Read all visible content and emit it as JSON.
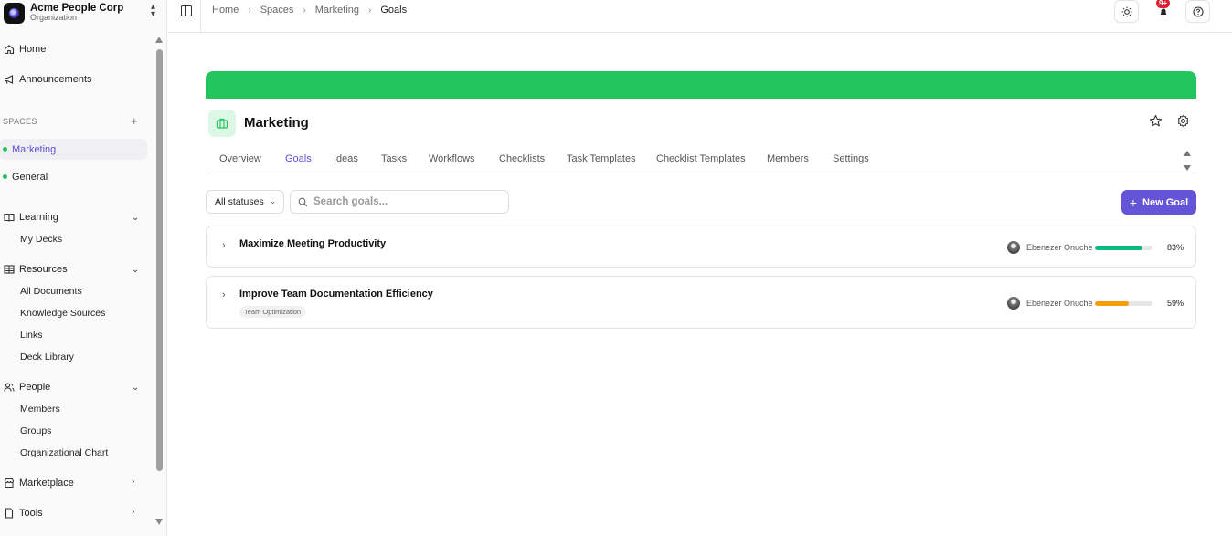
{
  "org": {
    "name": "Acme People Corp",
    "subtitle": "Organization"
  },
  "sidebar": {
    "home": "Home",
    "announcements": "Announcements",
    "spaces_label": "SPACES",
    "spaces": [
      {
        "label": "Marketing",
        "active": true
      },
      {
        "label": "General",
        "active": false
      }
    ],
    "learning": {
      "label": "Learning",
      "items": [
        "My Decks"
      ]
    },
    "resources": {
      "label": "Resources",
      "items": [
        "All Documents",
        "Knowledge Sources",
        "Links",
        "Deck Library"
      ]
    },
    "people": {
      "label": "People",
      "items": [
        "Members",
        "Groups",
        "Organizational Chart"
      ]
    },
    "marketplace": "Marketplace",
    "tools": "Tools"
  },
  "breadcrumb": [
    "Home",
    "Spaces",
    "Marketing",
    "Goals"
  ],
  "notifications": {
    "badge": "9+"
  },
  "space": {
    "title": "Marketing",
    "banner_color": "#22c55e"
  },
  "tabs": [
    "Overview",
    "Goals",
    "Ideas",
    "Tasks",
    "Workflows",
    "Checklists",
    "Task Templates",
    "Checklist Templates",
    "Members",
    "Settings"
  ],
  "active_tab": "Goals",
  "filters": {
    "status": "All statuses",
    "search_placeholder": "Search goals..."
  },
  "new_goal_label": "New Goal",
  "accent_color": "#6455d8",
  "goals": [
    {
      "title": "Maximize Meeting Productivity",
      "tag": "",
      "owner": "Ebenezer Onuche",
      "progress": 83,
      "progress_label": "83%",
      "color": "#10b981"
    },
    {
      "title": "Improve Team Documentation Efficiency",
      "tag": "Team Optimization",
      "owner": "Ebenezer Onuche",
      "progress": 59,
      "progress_label": "59%",
      "color": "#f59e0b"
    }
  ]
}
